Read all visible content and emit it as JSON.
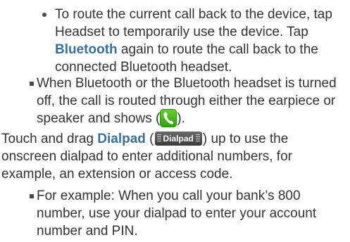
{
  "paragraphs": {
    "headset_item": {
      "pre": "To route the current call back to the device, tap Headset to temporarily use the device. Tap ",
      "bold": "Bluetooth",
      "post": " again to route the call back to the connected Bluetooth headset."
    },
    "bluetooth_off_item": {
      "pre": "When Bluetooth or the Bluetooth headset is turned off, the call is routed through either the earpiece or speaker and shows (",
      "icon": "phone-call-icon",
      "post": ")."
    },
    "dialpad_para": {
      "pre": "Touch and drag ",
      "bold": "Dialpad",
      "open": " (",
      "badge_label": "Dialpad",
      "post": ") up to use the onscreen dialpad to enter additional numbers, for example, an extension or access code."
    },
    "example_item": {
      "text": "For example: When you call your bank’s 800 number, use your dialpad to enter your account number and PIN."
    }
  },
  "colors": {
    "text": "#333333",
    "bold_accent": "#3d6f91",
    "call_icon_green": "#4cbb22",
    "badge_bg": "#4a4a4a"
  }
}
